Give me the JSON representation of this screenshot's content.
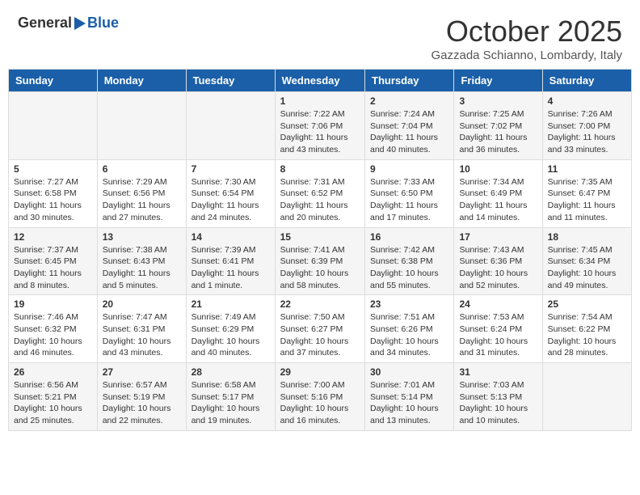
{
  "logo": {
    "general": "General",
    "blue": "Blue"
  },
  "title": {
    "month": "October 2025",
    "location": "Gazzada Schianno, Lombardy, Italy"
  },
  "weekdays": [
    "Sunday",
    "Monday",
    "Tuesday",
    "Wednesday",
    "Thursday",
    "Friday",
    "Saturday"
  ],
  "weeks": [
    [
      {
        "day": "",
        "info": ""
      },
      {
        "day": "",
        "info": ""
      },
      {
        "day": "",
        "info": ""
      },
      {
        "day": "1",
        "info": "Sunrise: 7:22 AM\nSunset: 7:06 PM\nDaylight: 11 hours and 43 minutes."
      },
      {
        "day": "2",
        "info": "Sunrise: 7:24 AM\nSunset: 7:04 PM\nDaylight: 11 hours and 40 minutes."
      },
      {
        "day": "3",
        "info": "Sunrise: 7:25 AM\nSunset: 7:02 PM\nDaylight: 11 hours and 36 minutes."
      },
      {
        "day": "4",
        "info": "Sunrise: 7:26 AM\nSunset: 7:00 PM\nDaylight: 11 hours and 33 minutes."
      }
    ],
    [
      {
        "day": "5",
        "info": "Sunrise: 7:27 AM\nSunset: 6:58 PM\nDaylight: 11 hours and 30 minutes."
      },
      {
        "day": "6",
        "info": "Sunrise: 7:29 AM\nSunset: 6:56 PM\nDaylight: 11 hours and 27 minutes."
      },
      {
        "day": "7",
        "info": "Sunrise: 7:30 AM\nSunset: 6:54 PM\nDaylight: 11 hours and 24 minutes."
      },
      {
        "day": "8",
        "info": "Sunrise: 7:31 AM\nSunset: 6:52 PM\nDaylight: 11 hours and 20 minutes."
      },
      {
        "day": "9",
        "info": "Sunrise: 7:33 AM\nSunset: 6:50 PM\nDaylight: 11 hours and 17 minutes."
      },
      {
        "day": "10",
        "info": "Sunrise: 7:34 AM\nSunset: 6:49 PM\nDaylight: 11 hours and 14 minutes."
      },
      {
        "day": "11",
        "info": "Sunrise: 7:35 AM\nSunset: 6:47 PM\nDaylight: 11 hours and 11 minutes."
      }
    ],
    [
      {
        "day": "12",
        "info": "Sunrise: 7:37 AM\nSunset: 6:45 PM\nDaylight: 11 hours and 8 minutes."
      },
      {
        "day": "13",
        "info": "Sunrise: 7:38 AM\nSunset: 6:43 PM\nDaylight: 11 hours and 5 minutes."
      },
      {
        "day": "14",
        "info": "Sunrise: 7:39 AM\nSunset: 6:41 PM\nDaylight: 11 hours and 1 minute."
      },
      {
        "day": "15",
        "info": "Sunrise: 7:41 AM\nSunset: 6:39 PM\nDaylight: 10 hours and 58 minutes."
      },
      {
        "day": "16",
        "info": "Sunrise: 7:42 AM\nSunset: 6:38 PM\nDaylight: 10 hours and 55 minutes."
      },
      {
        "day": "17",
        "info": "Sunrise: 7:43 AM\nSunset: 6:36 PM\nDaylight: 10 hours and 52 minutes."
      },
      {
        "day": "18",
        "info": "Sunrise: 7:45 AM\nSunset: 6:34 PM\nDaylight: 10 hours and 49 minutes."
      }
    ],
    [
      {
        "day": "19",
        "info": "Sunrise: 7:46 AM\nSunset: 6:32 PM\nDaylight: 10 hours and 46 minutes."
      },
      {
        "day": "20",
        "info": "Sunrise: 7:47 AM\nSunset: 6:31 PM\nDaylight: 10 hours and 43 minutes."
      },
      {
        "day": "21",
        "info": "Sunrise: 7:49 AM\nSunset: 6:29 PM\nDaylight: 10 hours and 40 minutes."
      },
      {
        "day": "22",
        "info": "Sunrise: 7:50 AM\nSunset: 6:27 PM\nDaylight: 10 hours and 37 minutes."
      },
      {
        "day": "23",
        "info": "Sunrise: 7:51 AM\nSunset: 6:26 PM\nDaylight: 10 hours and 34 minutes."
      },
      {
        "day": "24",
        "info": "Sunrise: 7:53 AM\nSunset: 6:24 PM\nDaylight: 10 hours and 31 minutes."
      },
      {
        "day": "25",
        "info": "Sunrise: 7:54 AM\nSunset: 6:22 PM\nDaylight: 10 hours and 28 minutes."
      }
    ],
    [
      {
        "day": "26",
        "info": "Sunrise: 6:56 AM\nSunset: 5:21 PM\nDaylight: 10 hours and 25 minutes."
      },
      {
        "day": "27",
        "info": "Sunrise: 6:57 AM\nSunset: 5:19 PM\nDaylight: 10 hours and 22 minutes."
      },
      {
        "day": "28",
        "info": "Sunrise: 6:58 AM\nSunset: 5:17 PM\nDaylight: 10 hours and 19 minutes."
      },
      {
        "day": "29",
        "info": "Sunrise: 7:00 AM\nSunset: 5:16 PM\nDaylight: 10 hours and 16 minutes."
      },
      {
        "day": "30",
        "info": "Sunrise: 7:01 AM\nSunset: 5:14 PM\nDaylight: 10 hours and 13 minutes."
      },
      {
        "day": "31",
        "info": "Sunrise: 7:03 AM\nSunset: 5:13 PM\nDaylight: 10 hours and 10 minutes."
      },
      {
        "day": "",
        "info": ""
      }
    ]
  ]
}
